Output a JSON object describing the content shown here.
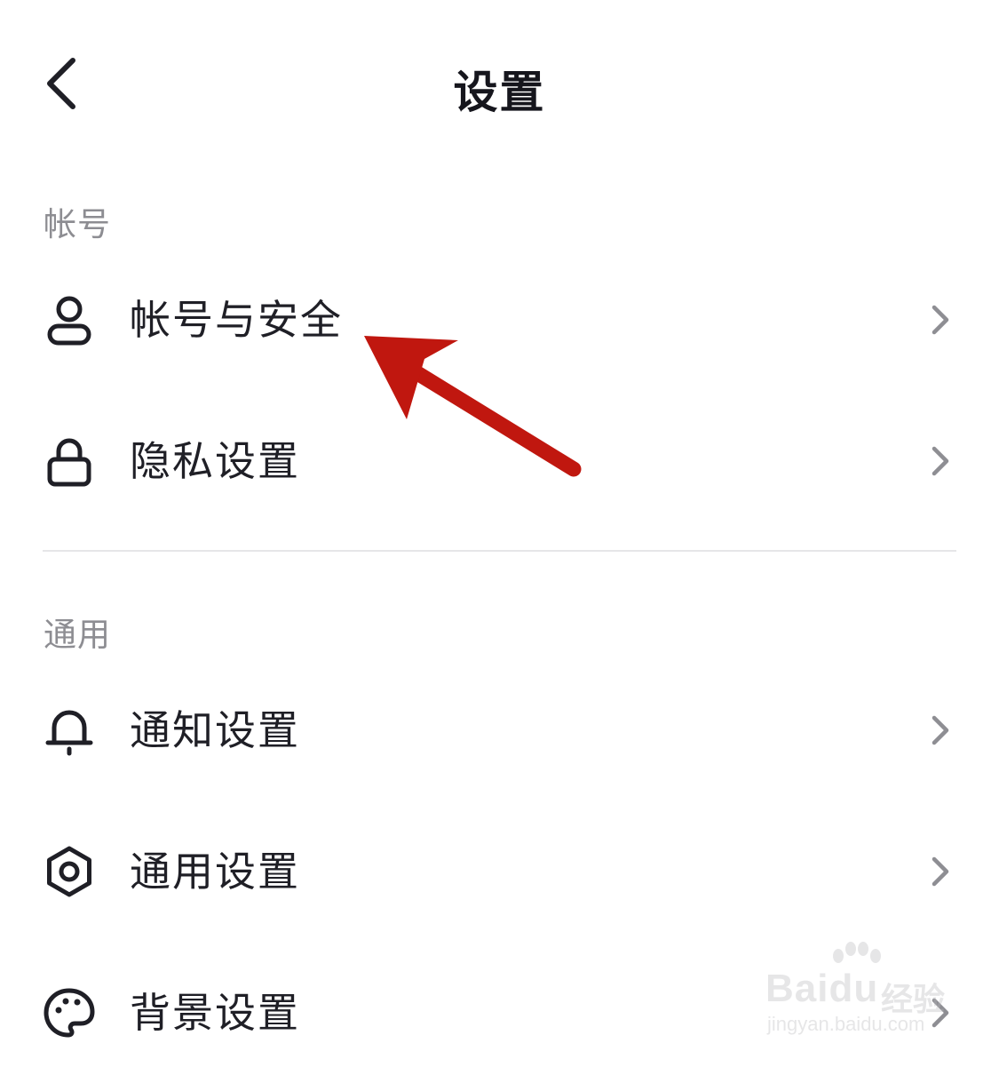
{
  "header": {
    "title": "设置",
    "back_icon": "chevron-left-icon"
  },
  "sections": [
    {
      "label": "帐号",
      "items": [
        {
          "label": "帐号与安全",
          "icon": "person-icon"
        },
        {
          "label": "隐私设置",
          "icon": "lock-icon"
        }
      ]
    },
    {
      "label": "通用",
      "items": [
        {
          "label": "通知设置",
          "icon": "bell-icon"
        },
        {
          "label": "通用设置",
          "icon": "gear-icon"
        },
        {
          "label": "背景设置",
          "icon": "palette-icon"
        }
      ]
    }
  ],
  "annotation": {
    "arrow_color": "#c0170f"
  },
  "watermark": {
    "brand": "Baidu",
    "suffix": "经验",
    "url": "jingyan.baidu.com"
  },
  "colors": {
    "text": "#1f1f26",
    "section_label": "#8d8d92",
    "chevron": "#8e8e93",
    "divider": "#e6e6e8"
  }
}
